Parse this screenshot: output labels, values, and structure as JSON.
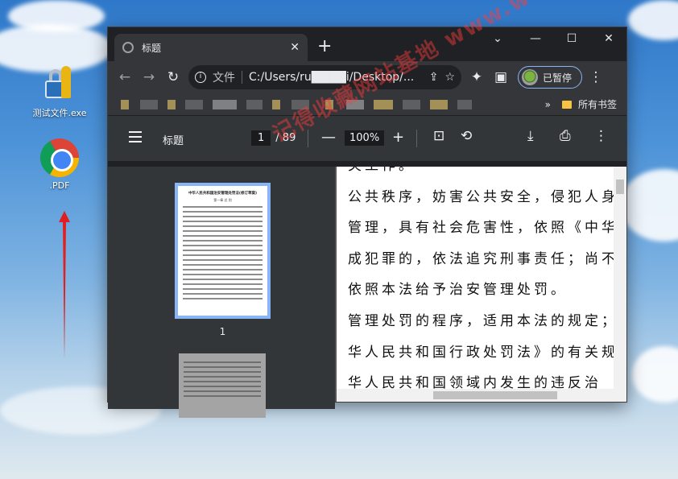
{
  "desktop": {
    "icons": [
      {
        "label": "测试文件.exe",
        "icon": "lock-key-icon"
      },
      {
        "label": ".PDF",
        "icon": "chrome-icon"
      }
    ]
  },
  "browser": {
    "tab_title": "标题",
    "new_tab": "+",
    "window_controls": {
      "dropdown": "⌄",
      "minimize": "—",
      "maximize": "☐",
      "close": "✕"
    },
    "nav": {
      "back": "←",
      "forward": "→",
      "reload": "↻"
    },
    "omnibox": {
      "label": "文件",
      "url": "C:/Users/ru████i/Desktop/...",
      "share_icon": "share-icon",
      "star_icon": "star-icon"
    },
    "profile_status": "已暂停",
    "bookmarks_all": "所有书签",
    "bookmarks_chevron": "»"
  },
  "pdf": {
    "doc_title": "标题",
    "current_page": "1",
    "total_pages": "/ 89",
    "zoom": "100%",
    "zoom_out": "—",
    "zoom_in": "+",
    "thumbnail_number": "1",
    "thumbnail_title": "中华人民共和国治安管理处罚法(修订草案)",
    "thumbnail_heading": "第一章 总 则",
    "lines": [
      "关工作。",
      "公共秩序，妨害公共安全，侵犯人身",
      "管理，具有社会危害性，依照《中华",
      "成犯罪的，依法追究刑事责任；尚不",
      "依照本法给予治安管理处罚。",
      "管理处罚的程序，适用本法的规定；",
      "华人民共和国行政处罚法》的有关规",
      "华人民共和国领域内发生的违反治"
    ]
  },
  "watermark": "记得收藏网站基地 www.webase.com"
}
